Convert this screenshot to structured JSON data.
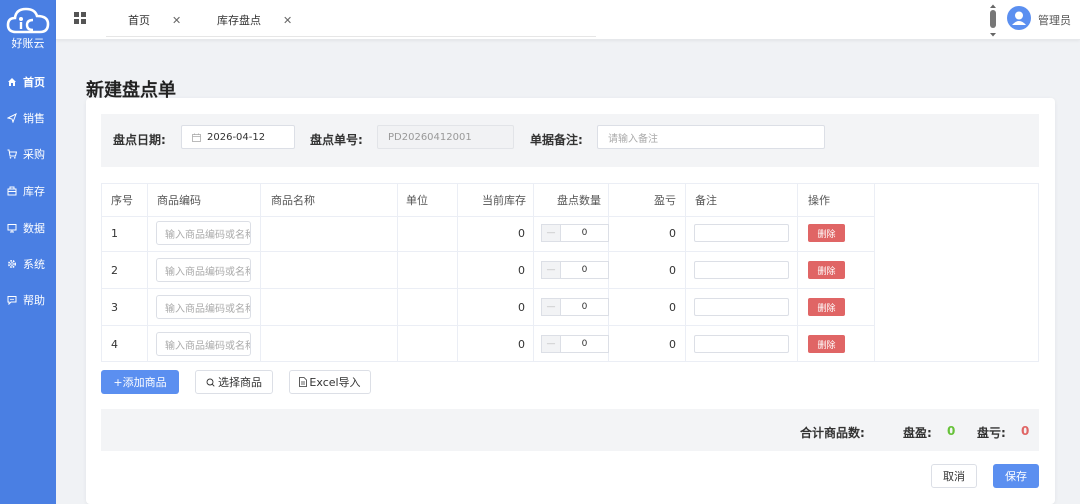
{
  "app": {
    "logo_text": "好账云"
  },
  "sidebar": {
    "items": [
      {
        "label": "首页",
        "icon": "home-icon"
      },
      {
        "label": "销售",
        "icon": "send-icon"
      },
      {
        "label": "采购",
        "icon": "cart-icon"
      },
      {
        "label": "库存",
        "icon": "box-icon"
      },
      {
        "label": "数据",
        "icon": "monitor-icon"
      },
      {
        "label": "系统",
        "icon": "gear-icon"
      },
      {
        "label": "帮助",
        "icon": "chat-icon"
      }
    ]
  },
  "topbar": {
    "tabs": [
      {
        "label": "首页",
        "close": "✕"
      },
      {
        "label": "库存盘点",
        "close": "✕"
      }
    ],
    "user": "管理员"
  },
  "page": {
    "title": "新建盘点单"
  },
  "form": {
    "date_label": "盘点日期:",
    "date_value": "2026-04-12",
    "number_label": "盘点单号:",
    "number_value": "PD20260412001",
    "remark_label": "单据备注:",
    "remark_placeholder": "请输入备注"
  },
  "table": {
    "headers": [
      "序号",
      "商品编码",
      "商品名称",
      "单位",
      "当前库存",
      "盘点数量",
      "盈亏",
      "备注",
      "操作"
    ],
    "code_placeholder": "输入商品编码或名称",
    "delete_label": "删除",
    "stepper_minus": "—",
    "rows": [
      {
        "index": "1",
        "stock": "0",
        "count": "0",
        "diff": "0"
      },
      {
        "index": "2",
        "stock": "0",
        "count": "0",
        "diff": "0"
      },
      {
        "index": "3",
        "stock": "0",
        "count": "0",
        "diff": "0"
      },
      {
        "index": "4",
        "stock": "0",
        "count": "0",
        "diff": "0"
      }
    ]
  },
  "actions": {
    "add_label": "+添加商品",
    "select_label": "选择商品",
    "excel_label": "Excel导入"
  },
  "summary": {
    "total_label": "合计商品数:",
    "gain_label": "盘盈:",
    "gain_value": "0",
    "loss_label": "盘亏:",
    "loss_value": "0"
  },
  "footer": {
    "cancel_label": "取消",
    "save_label": "保存"
  },
  "colors": {
    "primary": "#5b8ff0",
    "sidebar": "#4a7fe3",
    "danger": "#e06565",
    "success": "#67c23a"
  }
}
